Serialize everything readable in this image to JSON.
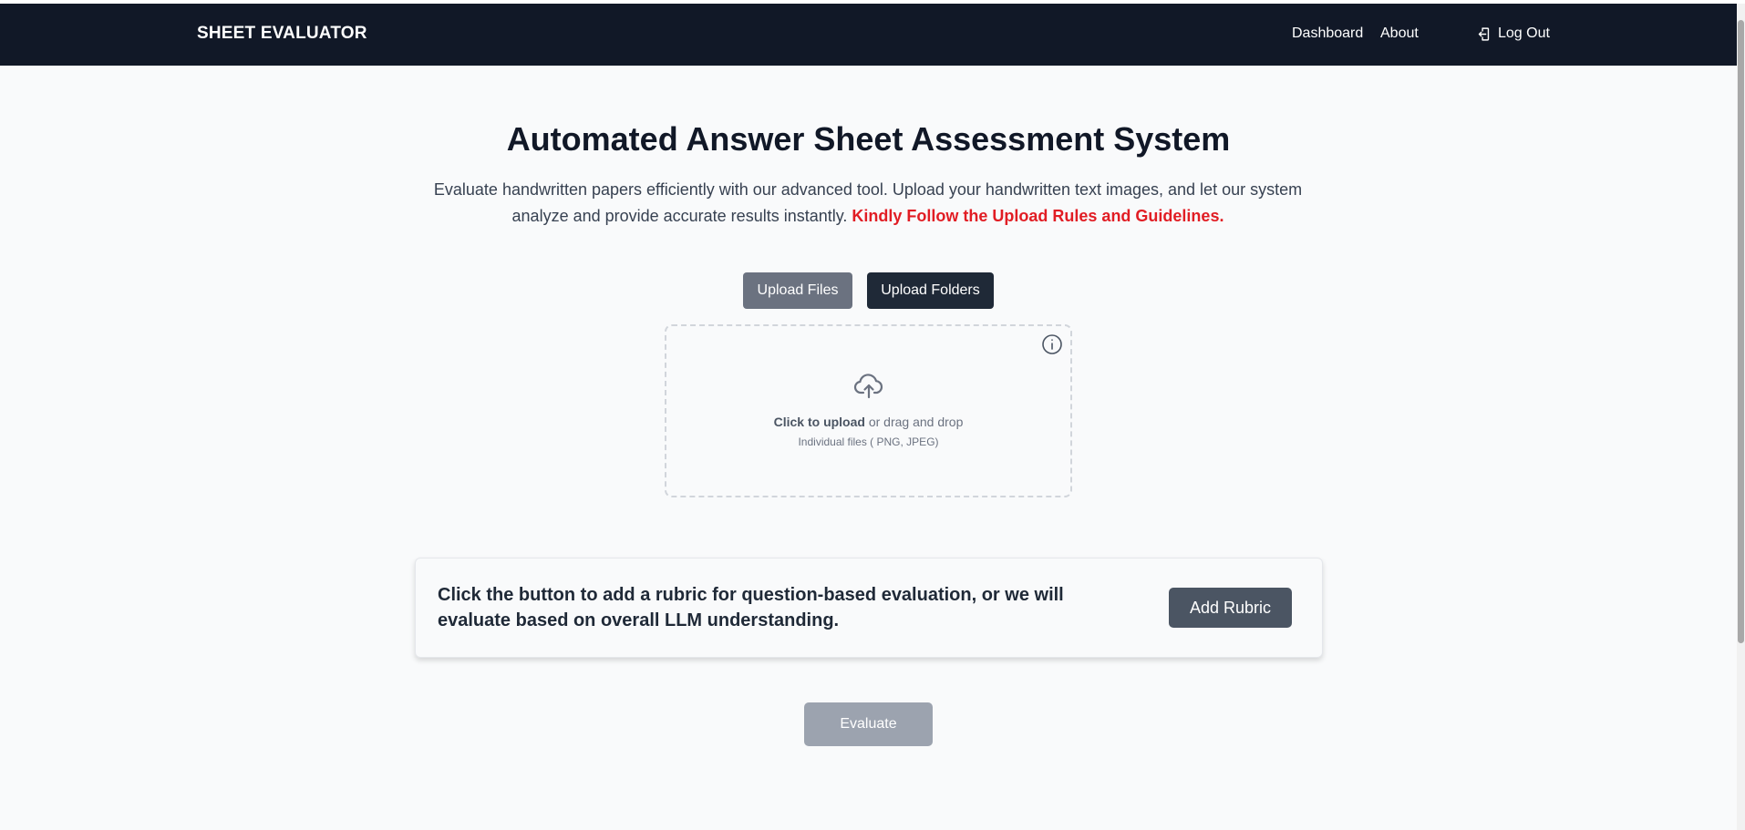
{
  "navbar": {
    "brand": "SHEET EVALUATOR",
    "links": [
      "Dashboard",
      "About"
    ],
    "logout_label": "Log Out",
    "logout_icon": "logout-icon"
  },
  "hero": {
    "title": "Automated Answer Sheet Assessment System",
    "description": "Evaluate handwritten papers efficiently with our advanced tool. Upload your handwritten text images, and let our system analyze and provide accurate results instantly.",
    "warning": "Kindly Follow the Upload Rules and Guidelines."
  },
  "upload": {
    "files_label": "Upload Files",
    "folders_label": "Upload Folders",
    "info_icon": "info-icon",
    "cloud_icon": "cloud-upload-icon",
    "click_label": "Click to upload",
    "drag_label": "or drag and drop",
    "hint": "Individual files ( PNG, JPEG)"
  },
  "rubric": {
    "text": "Click the button to add a rubric for question-based evaluation, or we will evaluate based on overall LLM understanding.",
    "button_label": "Add Rubric"
  },
  "evaluate": {
    "label": "Evaluate"
  },
  "colors": {
    "navbar_bg": "#111827",
    "warning": "#e11d24",
    "upload_files_bg": "#6b7280",
    "upload_folders_bg": "#1f2937",
    "add_rubric_bg": "#4b5563",
    "evaluate_disabled_bg": "#9ca3af"
  }
}
